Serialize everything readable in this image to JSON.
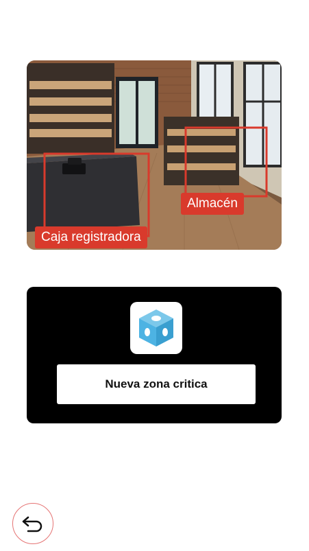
{
  "photo": {
    "zones": {
      "caja": "Caja registradora",
      "almacen": "Almacén"
    }
  },
  "panel": {
    "button_label": "Nueva zona critica",
    "icon": "cube-icon"
  },
  "nav": {
    "back_icon": "back-arrow-icon"
  },
  "colors": {
    "zone_label": "#d93a2c",
    "panel_bg": "#000000",
    "cube": "#4db3e3"
  }
}
